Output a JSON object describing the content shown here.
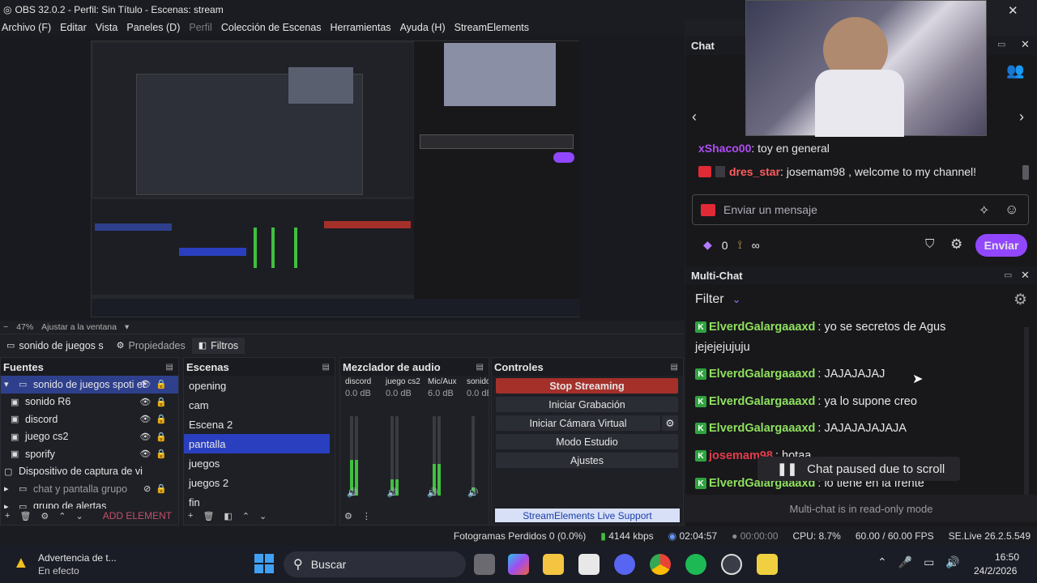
{
  "window": {
    "title": "OBS 32.0.2 - Perfil: Sin Título - Escenas: stream",
    "close_glyph": "✕"
  },
  "menu": [
    {
      "label": "Archivo (F)",
      "dim": false
    },
    {
      "label": "Editar",
      "dim": false
    },
    {
      "label": "Vista",
      "dim": false
    },
    {
      "label": "Paneles (D)",
      "dim": false
    },
    {
      "label": "Perfil",
      "dim": true
    },
    {
      "label": "Colección de Escenas",
      "dim": false
    },
    {
      "label": "Herramientas",
      "dim": false
    },
    {
      "label": "Ayuda (H)",
      "dim": false
    },
    {
      "label": "StreamElements",
      "dim": false
    }
  ],
  "preview_bar": {
    "zoom": "47%",
    "fit": "Ajustar a la ventana"
  },
  "source_bar": {
    "current": "sonido de juegos s",
    "tab_props": "Propiedades",
    "tab_filters": "Filtros"
  },
  "sources": {
    "title": "Fuentes",
    "items": [
      {
        "label": "sonido de juegos spoti et",
        "selected": true,
        "icon": "folder-icon"
      },
      {
        "label": "sonido R6",
        "selected": false,
        "icon": "monitor-icon"
      },
      {
        "label": "discord",
        "selected": false,
        "icon": "monitor-icon"
      },
      {
        "label": "juego cs2",
        "selected": false,
        "icon": "monitor-icon"
      },
      {
        "label": "sporify",
        "selected": false,
        "icon": "monitor-icon"
      },
      {
        "label": "Dispositivo de captura de vi",
        "selected": false,
        "icon": "camera-icon"
      },
      {
        "label": "chat y pantalla grupo",
        "selected": false,
        "icon": "folder-icon"
      },
      {
        "label": "grupo de alertas",
        "selected": false,
        "icon": "folder-icon"
      }
    ],
    "add_label": "ADD ELEMENT"
  },
  "scenes": {
    "title": "Escenas",
    "items": [
      {
        "label": "opening",
        "selected": false
      },
      {
        "label": "cam",
        "selected": false
      },
      {
        "label": "Escena 2",
        "selected": false
      },
      {
        "label": "pantalla",
        "selected": true
      },
      {
        "label": "juegos",
        "selected": false
      },
      {
        "label": "juegos 2",
        "selected": false
      },
      {
        "label": "fin",
        "selected": false
      }
    ]
  },
  "mixer": {
    "title": "Mezclador de audio",
    "channels": [
      {
        "name": "discord",
        "db": "0.0 dB",
        "level": 0.45
      },
      {
        "name": "juego cs2",
        "db": "0.0 dB",
        "level": 0.2
      },
      {
        "name": "Mic/Aux",
        "db": "6.0 dB",
        "level": 0.4
      },
      {
        "name": "sonido",
        "db": "0.0 dB",
        "level": 0.1
      }
    ]
  },
  "controls": {
    "title": "Controles",
    "stop_streaming": "Stop Streaming",
    "start_recording": "Iniciar Grabación",
    "virtual_cam": "Iniciar Cámara Virtual",
    "studio_mode": "Modo Estudio",
    "settings": "Ajustes",
    "support": "StreamElements Live Support"
  },
  "status": {
    "dropped": "Fotogramas Perdidos 0 (0.0%)",
    "kbps": "4144 kbps",
    "stream_time": "02:04:57",
    "rec_time": "00:00:00",
    "cpu": "CPU: 8.7%",
    "fps": "60.00 / 60.00 FPS",
    "version": "SE.Live 26.2.5.549"
  },
  "chat": {
    "title": "Chat",
    "messages": [
      {
        "user": "xShaco00",
        "text": ": toy en general",
        "color": "#b14cf7"
      },
      {
        "user": "dres_star",
        "text": ": josemam98 , welcome to my channel!",
        "color": "#ff5d5d"
      }
    ],
    "input_placeholder": "Enviar un mensaje",
    "points": "0",
    "send_label": "Enviar"
  },
  "multichat": {
    "title": "Multi-Chat",
    "filter_label": "Filter",
    "messages": [
      {
        "user": "ElverdGalargaaaxd",
        "text": ": yo se secretos de Agus"
      },
      {
        "user": "",
        "text": "jejejejujuju"
      },
      {
        "user": "ElverdGalargaaaxd",
        "text": ": JAJAJAJAJ"
      },
      {
        "user": "ElverdGalargaaaxd",
        "text": ": ya lo supone creo"
      },
      {
        "user": "ElverdGalargaaaxd",
        "text": ": JAJAJAJAJAJA"
      },
      {
        "user": "josemam98",
        "text": ": hotaa"
      },
      {
        "user": "ElverdGalargaaaxd",
        "text": ": lo tiene en la frente"
      }
    ],
    "paused_label": "Chat paused due to scroll",
    "readonly_label": "Multi-chat is in read-only mode"
  },
  "taskbar": {
    "notification_title": "Advertencia de t...",
    "notification_sub": "En efecto",
    "search": "Buscar",
    "time": "16:50",
    "date": "24/2/2026"
  },
  "colors": {
    "accent_purple": "#9147ff",
    "stop_red": "#a5302a",
    "selected_blue": "#2a3fbf",
    "meter_green": "#3fc03f"
  }
}
